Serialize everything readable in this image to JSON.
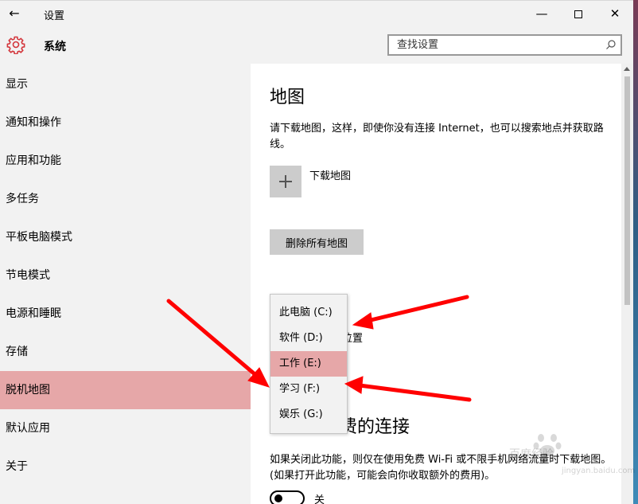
{
  "window": {
    "title": "设置",
    "back_glyph": "←",
    "minimize_glyph": "—",
    "close_glyph": "✕"
  },
  "header": {
    "section_title": "系统",
    "search_placeholder": "查找设置"
  },
  "sidebar": {
    "items": [
      {
        "label": "显示"
      },
      {
        "label": "通知和操作"
      },
      {
        "label": "应用和功能"
      },
      {
        "label": "多任务"
      },
      {
        "label": "平板电脑模式"
      },
      {
        "label": "节电模式"
      },
      {
        "label": "电源和睡眠"
      },
      {
        "label": "存储"
      },
      {
        "label": "脱机地图",
        "active": true
      },
      {
        "label": "默认应用"
      },
      {
        "label": "关于"
      }
    ]
  },
  "main": {
    "title": "地图",
    "description": "请下载地图，这样，即使你没有连接 Internet，也可以搜索地点并获取路线。",
    "download_label": "下载地图",
    "delete_button": "删除所有地图",
    "storage_label_partial": "的存储位置",
    "metered_title_partial": "费的连接",
    "metered_description": "如果关闭此功能，则仅在使用免费 Wi-Fi 或不限手机网络流量时下载地图。(如果打开此功能，可能会向你收取额外的费用)。",
    "toggle_label": "关"
  },
  "dropdown": {
    "options": [
      {
        "label": "此电脑 (C:)"
      },
      {
        "label": "软件 (D:)"
      },
      {
        "label": "工作 (E:)",
        "selected": true
      },
      {
        "label": "学习 (F:)"
      },
      {
        "label": "娱乐 (G:)"
      }
    ]
  },
  "watermark": {
    "main": "百度经验",
    "sub": "jingyan.baidu.com"
  },
  "colors": {
    "accent": "#e6a7a8",
    "arrow": "#ff0000",
    "chrome": "#f2f2f2"
  }
}
